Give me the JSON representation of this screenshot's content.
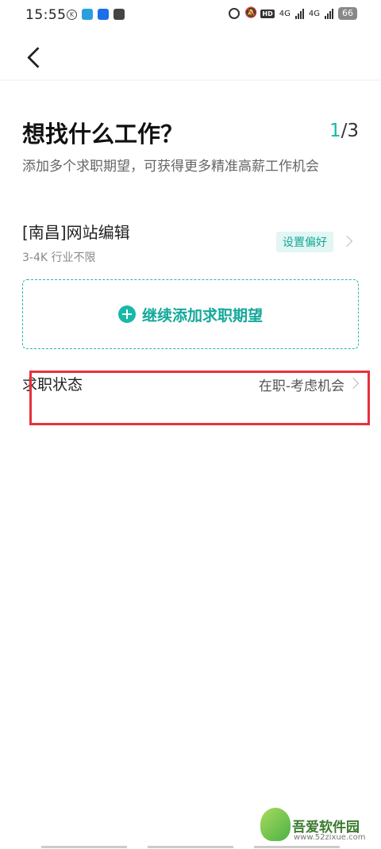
{
  "status_bar": {
    "time": "15:55",
    "left_icons": [
      "k-icon",
      "telegram-icon",
      "zhihu-icon",
      "message-icon"
    ],
    "right_icons": [
      "alarm-icon",
      "mute-icon",
      "hd-icon",
      "signal-4g-icon",
      "signal-4g-icon"
    ],
    "hd": "HD",
    "net1": "4G",
    "net2": "4G",
    "battery": "66"
  },
  "header": {
    "back_icon": "back-arrow-icon"
  },
  "page": {
    "title": "想找什么工作？",
    "pager_current": "1",
    "pager_total": "/3",
    "subtitle": "添加多个求职期望，可获得更多精准高薪工作机会"
  },
  "expectations": [
    {
      "title": "[南昌]网站编辑",
      "meta": "3-4K 行业不限",
      "pref_label": "设置偏好"
    }
  ],
  "add_button": {
    "label": "继续添加求职期望",
    "icon": "plus-circle-icon"
  },
  "job_status": {
    "label": "求职状态",
    "value": "在职-考虑机会"
  },
  "watermark": {
    "text": "吾爱软件园",
    "url": "www.52zixue.com"
  },
  "colors": {
    "accent": "#18b8a8",
    "highlight": "#e8303c",
    "tag_bg": "#e2f6f3"
  }
}
